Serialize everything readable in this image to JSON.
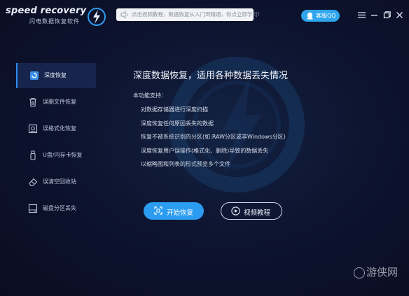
{
  "header": {
    "logo_text": "speed recovery",
    "logo_subtitle": "闪电数据恢复软件",
    "notice_text": "点击视频教程，数据恢复从入门到精通，你点立即学习!",
    "qq_label": "客服QQ"
  },
  "window_controls": {
    "menu_icon": "menu-icon",
    "minimize_icon": "minimize-icon",
    "restore_icon": "restore-icon",
    "close_icon": "close-icon"
  },
  "sidebar": {
    "items": [
      {
        "label": "深度恢复",
        "icon": "deep-recovery-icon",
        "active": true
      },
      {
        "label": "误删文件恢复",
        "icon": "trash-icon",
        "active": false
      },
      {
        "label": "误格式化恢复",
        "icon": "format-disk-icon",
        "active": false
      },
      {
        "label": "U盘/内存卡恢复",
        "icon": "usb-icon",
        "active": false
      },
      {
        "label": "误清空回收站",
        "icon": "eraser-icon",
        "active": false
      },
      {
        "label": "磁盘分区丢失",
        "icon": "partition-icon",
        "active": false
      }
    ]
  },
  "main": {
    "title": "深度数据恢复，适用各种数据丢失情况",
    "features_heading": "本功能支持：",
    "features": [
      "对数据存储器进行深度扫描",
      "深度恢复任何原因丢失的数据",
      "恢复不被系统识别的分区(如:RAW分区或非Windows分区)",
      "深度恢复用户误操作(格式化、删除)导致的数据丢失",
      "以缩略图和列表的形式预览多个文件"
    ],
    "start_button": "开始恢复",
    "video_button": "视频教程"
  },
  "watermark": {
    "text": "游侠网"
  },
  "colors": {
    "background": "#0b0e24",
    "accent": "#2b9cf0",
    "active_item": "#17244b"
  }
}
